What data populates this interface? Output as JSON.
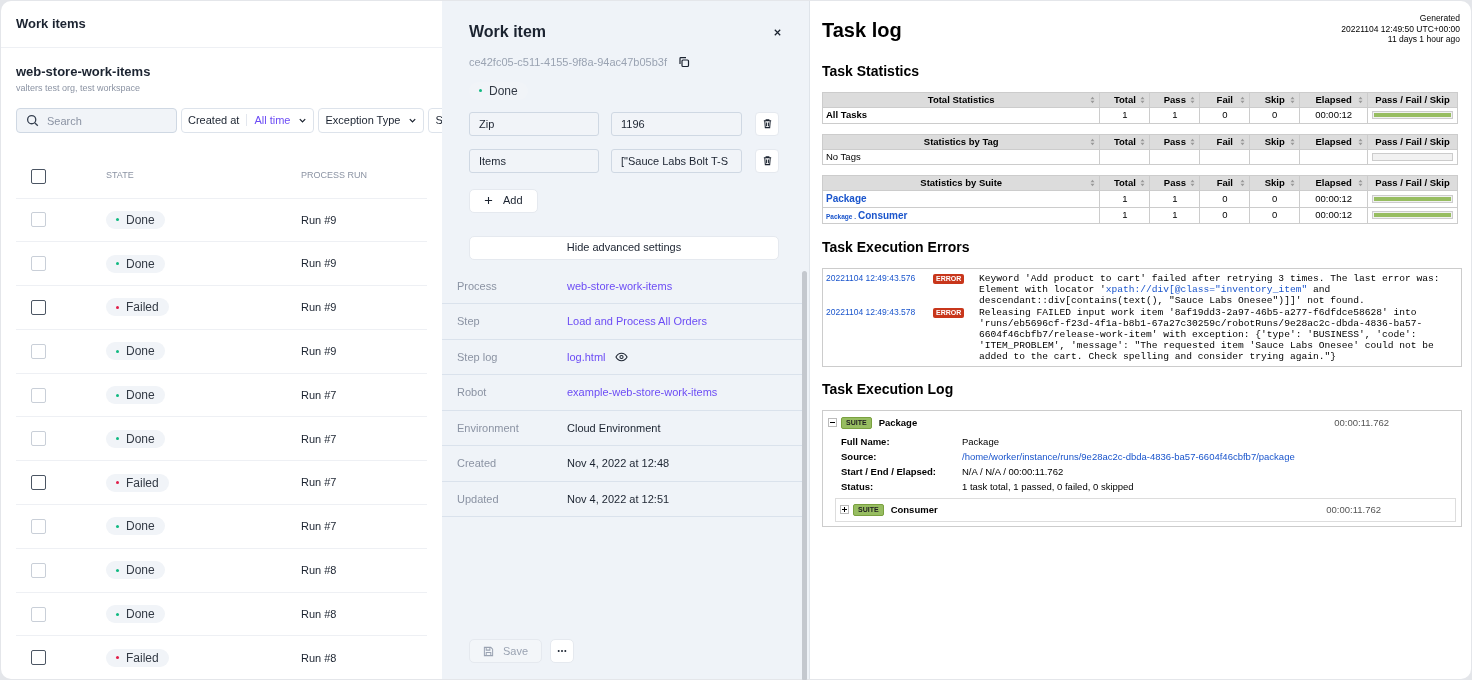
{
  "work_items": {
    "title": "Work items",
    "process_name": "web-store-work-items",
    "subtitle": "valters test org, test workspace",
    "search": {
      "placeholder": "Search"
    },
    "filters": [
      {
        "label": "Created at",
        "value": "All time"
      },
      {
        "label": "Exception Type"
      },
      {
        "label": "S"
      }
    ],
    "header_checkbox": {
      "checked": false
    },
    "columns": [
      "STATE",
      "PROCESS RUN"
    ],
    "rows": [
      {
        "state": "Done",
        "kind": "done",
        "run": "Run #9",
        "checked": false,
        "disabled": true
      },
      {
        "state": "Done",
        "kind": "done",
        "run": "Run #9",
        "checked": false,
        "disabled": true
      },
      {
        "state": "Failed",
        "kind": "failed",
        "run": "Run #9",
        "checked": false,
        "disabled": false
      },
      {
        "state": "Done",
        "kind": "done",
        "run": "Run #9",
        "checked": false,
        "disabled": true
      },
      {
        "state": "Done",
        "kind": "done",
        "run": "Run #7",
        "checked": false,
        "disabled": true
      },
      {
        "state": "Done",
        "kind": "done",
        "run": "Run #7",
        "checked": false,
        "disabled": true
      },
      {
        "state": "Failed",
        "kind": "failed",
        "run": "Run #7",
        "checked": false,
        "disabled": false
      },
      {
        "state": "Done",
        "kind": "done",
        "run": "Run #7",
        "checked": false,
        "disabled": true
      },
      {
        "state": "Done",
        "kind": "done",
        "run": "Run #8",
        "checked": false,
        "disabled": true
      },
      {
        "state": "Done",
        "kind": "done",
        "run": "Run #8",
        "checked": false,
        "disabled": true
      },
      {
        "state": "Failed",
        "kind": "failed",
        "run": "Run #8",
        "checked": false,
        "disabled": false
      }
    ]
  },
  "drawer": {
    "title": "Work item",
    "id": "ce42fc05-c511-4155-9f8a-94ac47b05b3f",
    "status": {
      "label": "Done",
      "kind": "done"
    },
    "payload": [
      {
        "key": "Zip",
        "value": "1196"
      },
      {
        "key": "Items",
        "value": "[\"Sauce Labs Bolt T-S"
      }
    ],
    "add_button": "Add",
    "advanced_button": "Hide advanced settings",
    "details": [
      {
        "label": "Process",
        "value": "web-store-work-items",
        "kind": "link"
      },
      {
        "label": "Step",
        "value": "Load and Process All Orders",
        "kind": "link"
      },
      {
        "label": "Step log",
        "value": "log.html",
        "kind": "preview_link"
      },
      {
        "label": "Robot",
        "value": "example-web-store-work-items",
        "kind": "link"
      },
      {
        "label": "Environment",
        "value": "Cloud Environment",
        "kind": "text"
      },
      {
        "label": "Created",
        "value": "Nov 4, 2022 at 12:48",
        "kind": "text"
      },
      {
        "label": "Updated",
        "value": "Nov 4, 2022 at 12:51",
        "kind": "text"
      }
    ],
    "save_button": {
      "label": "Save",
      "disabled": true
    }
  },
  "task_log": {
    "title": "Task log",
    "generated": [
      "Generated",
      "20221104 12:49:50 UTC+00:00",
      "11 days 1 hour ago"
    ],
    "statistics_title": "Task Statistics",
    "stat_tables": [
      {
        "columns": [
          "Total Statistics",
          "Total",
          "Pass",
          "Fail",
          "Skip",
          "Elapsed",
          "Pass / Fail / Skip"
        ],
        "rows": [
          {
            "kind": "total",
            "name": "All Tasks",
            "total": "1",
            "pass": "1",
            "fail": "0",
            "skip": "0",
            "elapsed": "00:00:12",
            "level": 1
          }
        ]
      },
      {
        "columns": [
          "Statistics by Tag",
          "Total",
          "Pass",
          "Fail",
          "Skip",
          "Elapsed",
          "Pass / Fail / Skip"
        ],
        "rows": [
          {
            "kind": "tag",
            "name": "No Tags"
          }
        ]
      },
      {
        "columns": [
          "Statistics by Suite",
          "Total",
          "Pass",
          "Fail",
          "Skip",
          "Elapsed",
          "Pass / Fail / Skip"
        ],
        "rows": [
          {
            "kind": "suite",
            "name": "Package",
            "total": "1",
            "pass": "1",
            "fail": "0",
            "skip": "0",
            "elapsed": "00:00:12",
            "level": 1
          },
          {
            "kind": "suite",
            "prefix": "Package .",
            "name": "Consumer",
            "total": "1",
            "pass": "1",
            "fail": "0",
            "skip": "0",
            "elapsed": "00:00:12",
            "level": 1
          }
        ]
      }
    ],
    "errors_title": "Task Execution Errors",
    "errors": [
      {
        "time": "20221104 12:49:43.576",
        "level": "ERROR",
        "message": [
          {
            "text": "Keyword 'Add product to cart' failed after retrying 3 times. The last error was: Element with locator '"
          },
          {
            "text": "xpath://div[@class=\"inventory_item\"",
            "link": true
          },
          {
            "text": " and descendant::div[contains(text(), \"Sauce Labs Onesee\")]]' not found."
          }
        ]
      },
      {
        "time": "20221104 12:49:43.578",
        "level": "ERROR",
        "message": [
          {
            "text": "Releasing FAILED input work item '8af19dd3-2a97-46b5-a277-f6dfdce58628' into 'runs/eb5696cf-f23d-4f1a-b8b1-67a27c30259c/robotRuns/9e28ac2c-dbda-4836-ba57-6604f46cbfb7/release-work-item' with exception: {'type': 'BUSINESS', 'code': 'ITEM_PROBLEM', 'message': \"The requested item 'Sauce Labs Onesee' could not be added to the cart. Check spelling and consider trying again.\"}"
          }
        ]
      }
    ],
    "log_title": "Task Execution Log",
    "suite": {
      "label": "SUITE",
      "name": "Package",
      "elapsed": "00:00:11.762",
      "expanded": true,
      "meta": [
        {
          "key": "Full Name:",
          "value": "Package",
          "kind": "text"
        },
        {
          "key": "Source:",
          "value": "/home/worker/instance/runs/9e28ac2c-dbda-4836-ba57-6604f46cbfb7/package",
          "kind": "link"
        },
        {
          "key": "Start / End / Elapsed:",
          "value": "N/A / N/A / 00:00:11.762",
          "kind": "text"
        },
        {
          "key": "Status:",
          "value": "1 task total, 1 passed, 0 failed, 0 skipped",
          "kind": "text"
        }
      ],
      "children": [
        {
          "label": "SUITE",
          "name": "Consumer",
          "elapsed": "00:00:11.762",
          "expanded": false
        }
      ]
    }
  }
}
